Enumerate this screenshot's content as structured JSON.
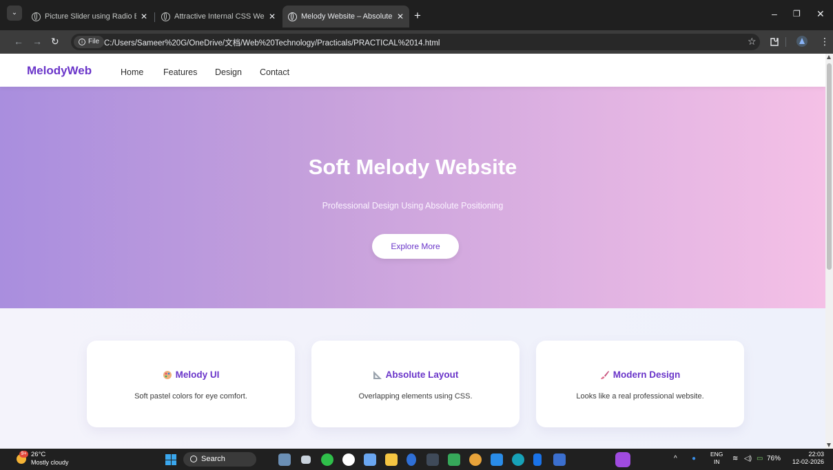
{
  "browser": {
    "tabs": [
      {
        "title": "Picture Slider using Radio Butto",
        "active": false
      },
      {
        "title": "Attractive Internal CSS Web Pag",
        "active": false
      },
      {
        "title": "Melody Website – Absolute Po",
        "active": true
      }
    ],
    "new_tab": "+",
    "close_glyph": "✕",
    "chip_label": "File",
    "url": "C:/Users/Sameer%20G/OneDrive/文档/Web%20Technology/Practicals/PRACTICAL%2014.html"
  },
  "site": {
    "logo": "MelodyWeb",
    "nav": [
      "Home",
      "Features",
      "Design",
      "Contact"
    ],
    "hero": {
      "title": "Soft Melody Website",
      "subtitle": "Professional Design Using Absolute Positioning",
      "button": "Explore More"
    },
    "cards": [
      {
        "icon": "palette-icon",
        "title": "Melody UI",
        "text": "Soft pastel colors for eye comfort."
      },
      {
        "icon": "triangle-ruler-icon",
        "title": "Absolute Layout",
        "text": "Overlapping elements using CSS."
      },
      {
        "icon": "paintbrush-icon",
        "title": "Modern Design",
        "text": "Looks like a real professional website."
      }
    ]
  },
  "taskbar": {
    "weather_temp": "26°C",
    "weather_desc": "Mostly cloudy",
    "weather_badge": "9+",
    "search": "Search",
    "lang_top": "ENG",
    "lang_bottom": "IN",
    "battery": "76%",
    "time": "22:03",
    "date": "12-02-2026"
  },
  "colors": {
    "brand": "#6a35c9",
    "hero_start": "#a98ede",
    "hero_end": "#f4c0e6"
  }
}
